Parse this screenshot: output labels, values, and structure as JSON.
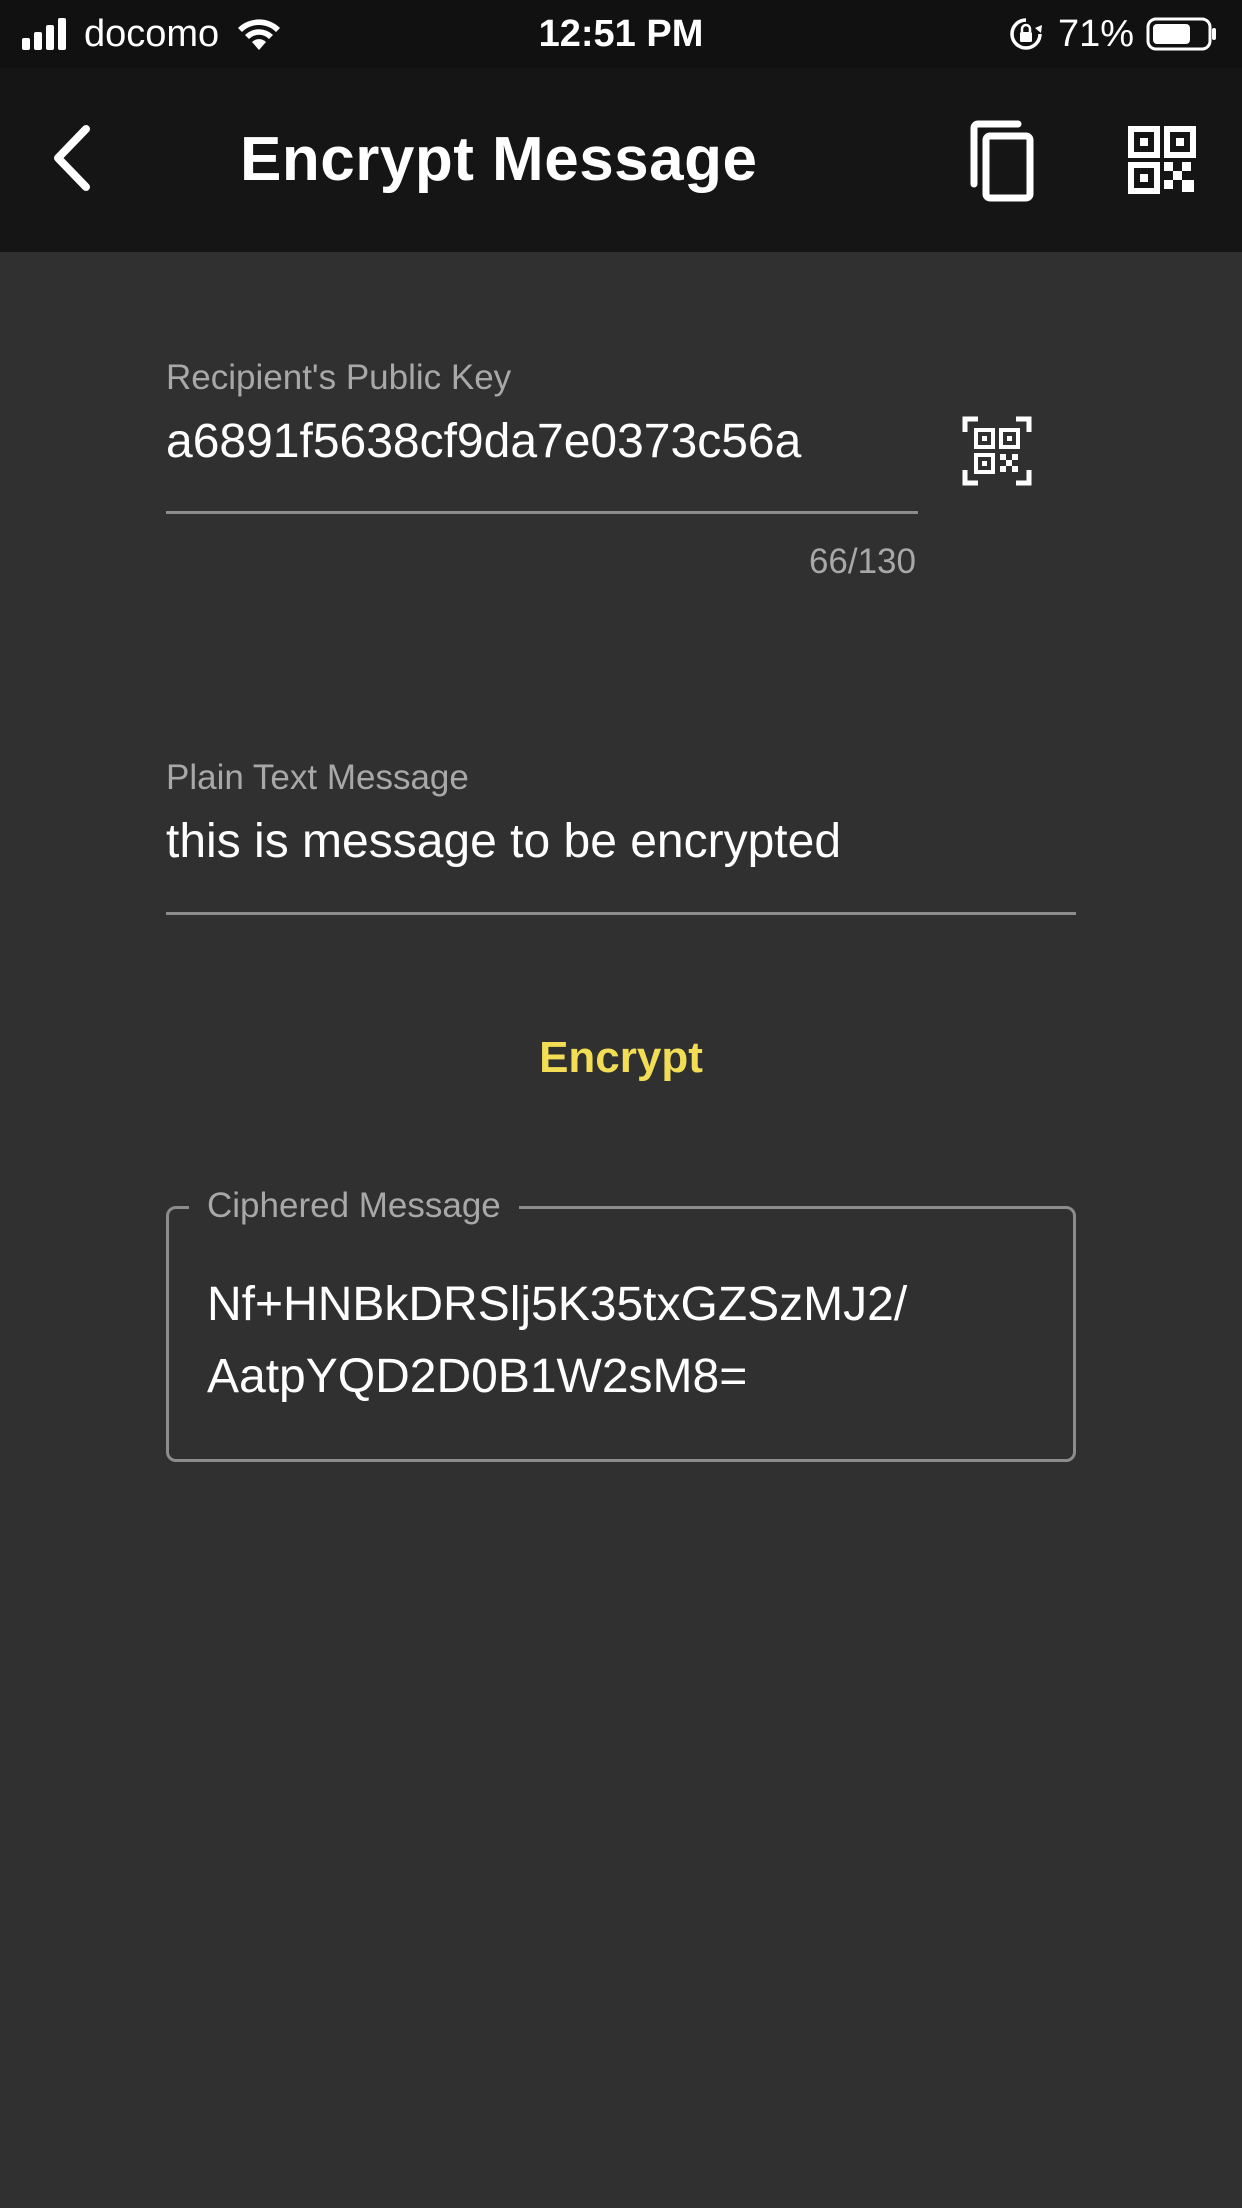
{
  "status_bar": {
    "carrier": "docomo",
    "time": "12:51 PM",
    "battery_percent": "71%",
    "battery_level": 0.71,
    "signal_bars": 4
  },
  "app_bar": {
    "title": "Encrypt Message",
    "back_icon": "chevron-left-icon",
    "copy_icon": "copy-icon",
    "qr_icon": "qr-code-icon"
  },
  "public_key_field": {
    "label": "Recipient's Public Key",
    "value": "a6891f5638cf9da7e0373c56a",
    "counter": "66/130",
    "scan_icon": "qr-scan-icon"
  },
  "message_field": {
    "label": "Plain Text Message",
    "value": "this is message to be encrypted"
  },
  "encrypt_button": {
    "label": "Encrypt",
    "color": "#f2dd55"
  },
  "cipher_field": {
    "label": "Ciphered Message",
    "line1": "Nf+HNBkDRSlj5K35txGZSzMJ2/",
    "line2": "AatpYQD2D0B1W2sM8="
  },
  "colors": {
    "background": "#303030",
    "app_bar": "#151515",
    "status_bar": "#111111",
    "label": "#a8a8a8",
    "text": "#ffffff",
    "accent": "#f2dd55"
  }
}
